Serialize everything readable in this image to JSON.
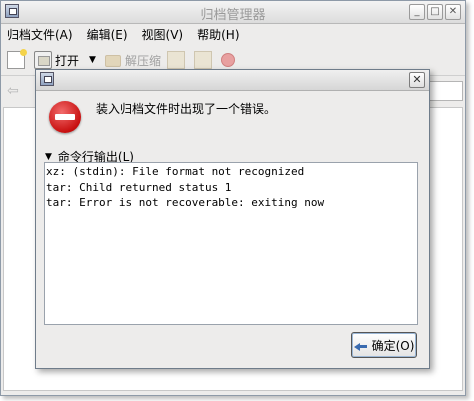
{
  "main_window": {
    "title": "归档管理器",
    "controls": [
      "_",
      "□",
      "✕"
    ]
  },
  "menubar": {
    "items": [
      "归档文件(A)",
      "编辑(E)",
      "视图(V)",
      "帮助(H)"
    ]
  },
  "toolbar": {
    "open_label": "打开",
    "extract_label": "解压缩",
    "nav_back": "⇦"
  },
  "dialog": {
    "close_glyph": "✕",
    "message": "装入归档文件时出现了一个错误。",
    "expander_arrow": "▼",
    "expander_label": "命令行输出(L)",
    "output_lines": [
      "xz: (stdin): File format not recognized",
      "tar: Child returned status 1",
      "tar: Error is not recoverable: exiting now"
    ],
    "ok_label": "确定(O)"
  },
  "colors": {
    "error_red": "#c81010",
    "dialog_bg": "#edeceb"
  }
}
